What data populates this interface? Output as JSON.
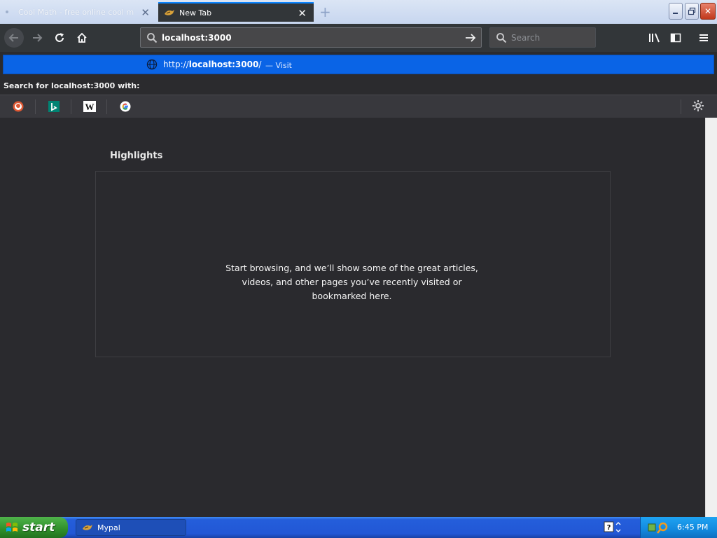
{
  "tabs": [
    {
      "label": "Cool Math - free online cool math",
      "active": false
    },
    {
      "label": "New Tab",
      "active": true
    }
  ],
  "toolbar": {
    "url_value": "localhost:3000",
    "search_placeholder": "Search"
  },
  "autocomplete": {
    "url_prefix": "http://",
    "url_host": "localhost:3000",
    "url_suffix": "/",
    "action": "— Visit",
    "search_with_label": "Search for localhost:3000 with:",
    "engines": [
      "duckduckgo",
      "bing",
      "wikipedia",
      "google"
    ]
  },
  "content": {
    "highlights_title": "Highlights",
    "empty_message": "Start browsing, and we’ll show some of the great articles, videos, and other pages you’ve recently visited or bookmarked here."
  },
  "taskbar": {
    "start_label": "start",
    "task_label": "Mypal",
    "clock": "6:45 PM"
  },
  "colors": {
    "accent": "#0a64e6",
    "content_bg": "#2a2a2e",
    "toolbar_bg": "#323639",
    "taskbar_blue": "#245edb",
    "start_green": "#2f8e2b"
  }
}
